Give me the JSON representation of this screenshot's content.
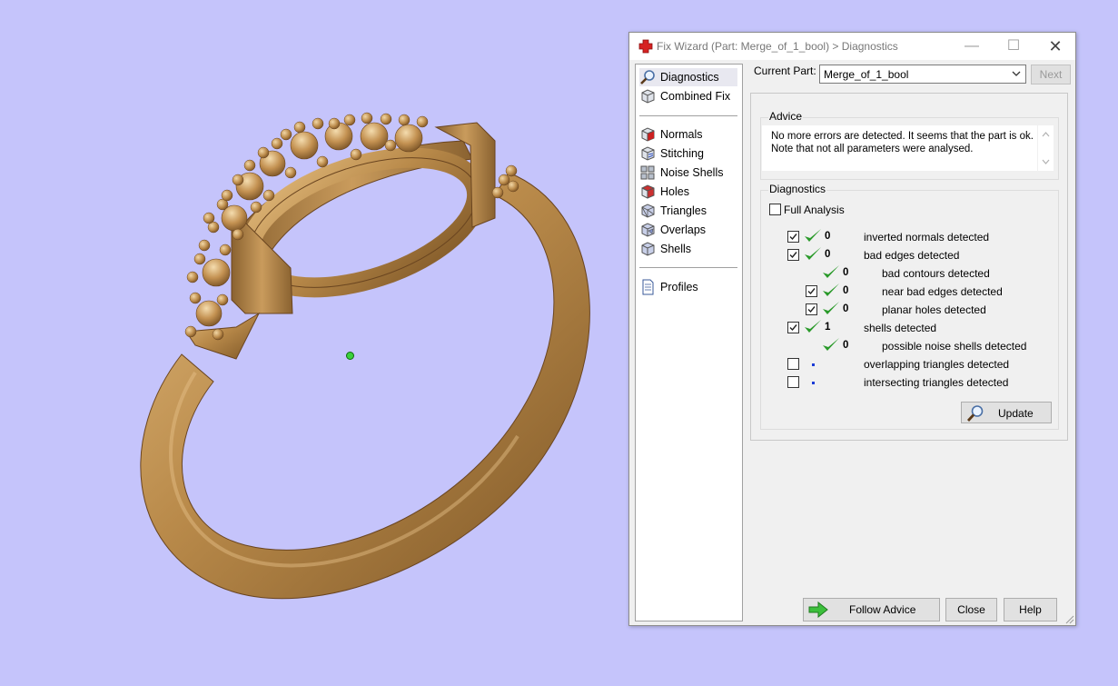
{
  "window": {
    "title": "Fix Wizard (Part: Merge_of_1_bool) > Diagnostics",
    "minimize_glyph": "—",
    "maximize_glyph": "☐",
    "close_glyph": "✕"
  },
  "nav": {
    "top_items": [
      {
        "label": "Diagnostics",
        "icon": "magnifier-icon",
        "selected": true
      },
      {
        "label": "Combined Fix",
        "icon": "cube-icon"
      }
    ],
    "fix_items": [
      {
        "label": "Normals",
        "icon": "normals-cube-icon"
      },
      {
        "label": "Stitching",
        "icon": "stitching-cube-icon"
      },
      {
        "label": "Noise Shells",
        "icon": "noise-shells-icon"
      },
      {
        "label": "Holes",
        "icon": "holes-cube-icon"
      },
      {
        "label": "Triangles",
        "icon": "triangles-cube-icon"
      },
      {
        "label": "Overlaps",
        "icon": "overlaps-cube-icon"
      },
      {
        "label": "Shells",
        "icon": "shells-cube-icon"
      }
    ],
    "bottom_items": [
      {
        "label": "Profiles",
        "icon": "document-icon"
      }
    ]
  },
  "current_part": {
    "label": "Current Part:",
    "value": "Merge_of_1_bool"
  },
  "next_button": "Next",
  "advice": {
    "title": "Advice",
    "line1": "No more errors are detected. It seems that the part is ok.",
    "line2": "Note that not all parameters were analysed."
  },
  "diagnostics": {
    "title": "Diagnostics",
    "full_analysis": {
      "label": "Full Analysis",
      "checked": false
    },
    "rows": [
      {
        "label": "inverted normals detected",
        "count": "0",
        "checked": true,
        "has_checkbox": true,
        "status": "ok",
        "indent": 0
      },
      {
        "label": "bad edges detected",
        "count": "0",
        "checked": true,
        "has_checkbox": true,
        "status": "ok",
        "indent": 0
      },
      {
        "label": "bad contours detected",
        "count": "0",
        "checked": false,
        "has_checkbox": false,
        "status": "ok",
        "indent": 1
      },
      {
        "label": "near bad edges detected",
        "count": "0",
        "checked": true,
        "has_checkbox": true,
        "status": "ok",
        "indent": 1
      },
      {
        "label": "planar holes detected",
        "count": "0",
        "checked": true,
        "has_checkbox": true,
        "status": "ok",
        "indent": 1
      },
      {
        "label": "shells detected",
        "count": "1",
        "checked": true,
        "has_checkbox": true,
        "status": "ok",
        "indent": 0
      },
      {
        "label": "possible noise shells detected",
        "count": "0",
        "checked": false,
        "has_checkbox": false,
        "status": "ok",
        "indent": 1
      },
      {
        "label": "overlapping triangles detected",
        "count": "",
        "checked": false,
        "has_checkbox": true,
        "status": "pending",
        "indent": 0
      },
      {
        "label": "intersecting triangles detected",
        "count": "",
        "checked": false,
        "has_checkbox": true,
        "status": "pending",
        "indent": 0
      }
    ],
    "update_button": "Update"
  },
  "buttons": {
    "follow_advice": "Follow Advice",
    "close": "Close",
    "help": "Help"
  },
  "colors": {
    "viewport_background": "#c5c4fb",
    "ring_gold": "#b98a4a",
    "check_green": "#2a9a2a",
    "pending_blue": "#1a3bd6"
  }
}
